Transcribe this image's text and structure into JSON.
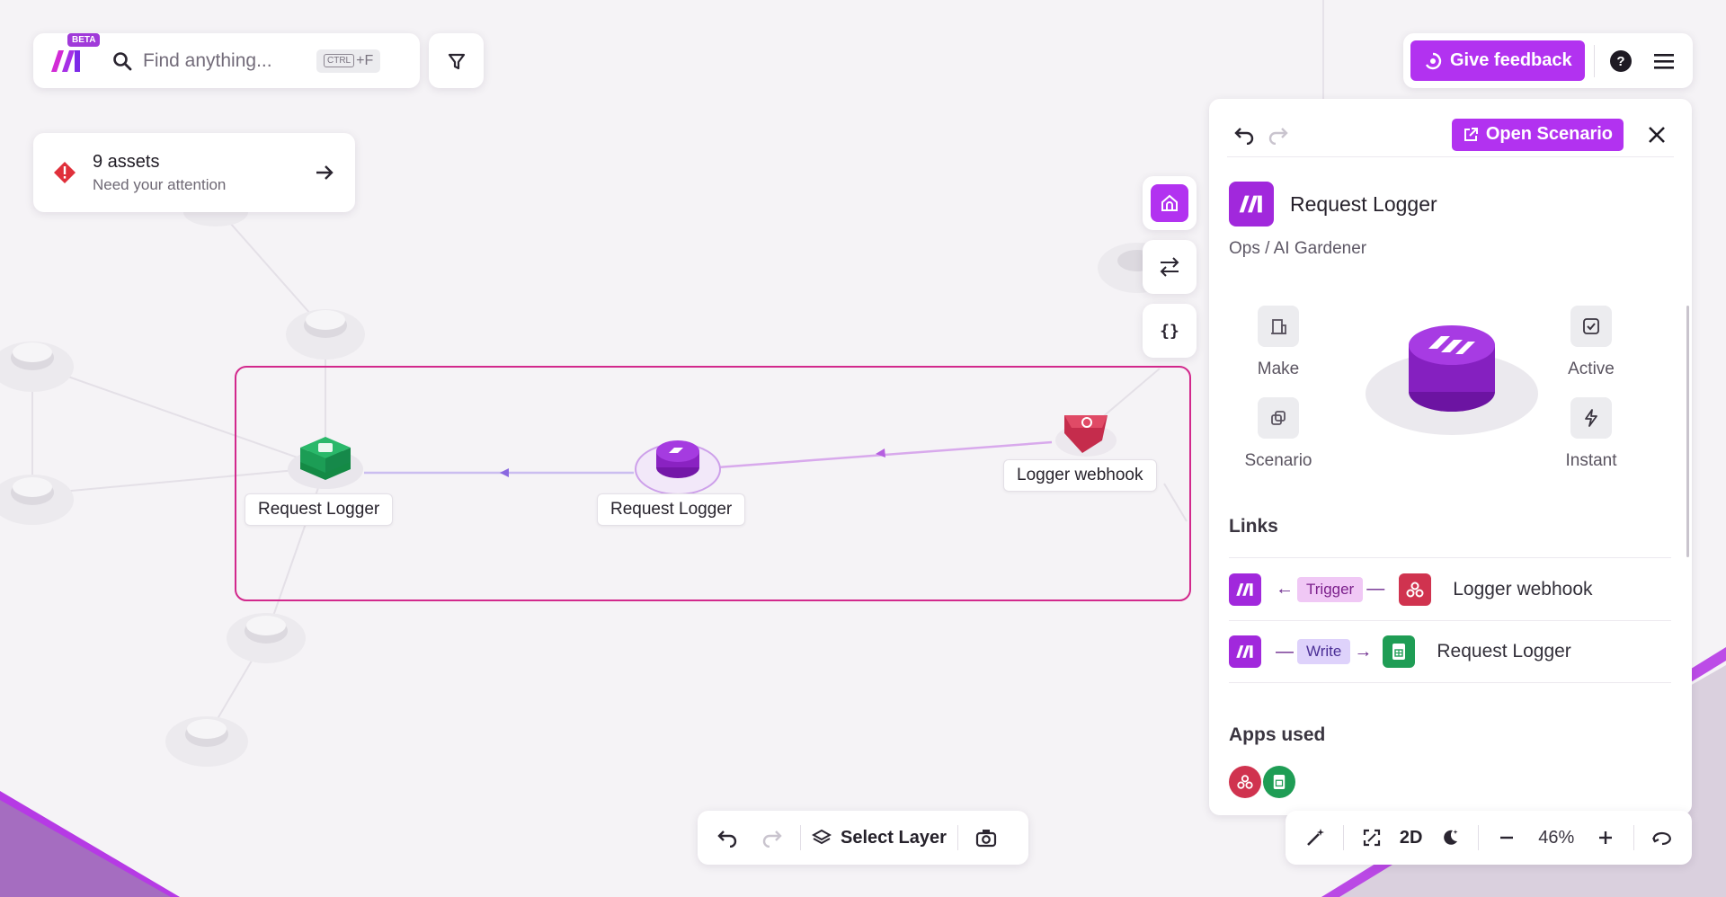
{
  "brand": {
    "badge": "BETA"
  },
  "search": {
    "placeholder": "Find anything...",
    "shortcut_key": "CTRL",
    "shortcut_suffix": "+F"
  },
  "alert": {
    "title": "9 assets",
    "subtitle": "Need your attention"
  },
  "topbar": {
    "feedback_label": "Give feedback"
  },
  "canvas": {
    "nodes": [
      {
        "label": "Request Logger",
        "kind": "google-sheets"
      },
      {
        "label": "Request Logger",
        "kind": "make-scenario"
      },
      {
        "label": "Logger webhook",
        "kind": "webhook"
      }
    ]
  },
  "panel": {
    "open_label": "Open Scenario",
    "title": "Request Logger",
    "breadcrumb": "Ops / AI Gardener",
    "properties": {
      "owner": "Make",
      "type": "Scenario",
      "status": "Active",
      "schedule": "Instant"
    },
    "links_title": "Links",
    "links": [
      {
        "tag": "Trigger",
        "target": "Logger webhook",
        "direction": "incoming"
      },
      {
        "tag": "Write",
        "target": "Request Logger",
        "direction": "outgoing"
      }
    ],
    "apps_title": "Apps used"
  },
  "bottom_toolbar": {
    "layer_label": "Select Layer"
  },
  "view_toolbar": {
    "mode_label": "2D",
    "zoom": "46%"
  },
  "colors": {
    "accent": "#b232f0",
    "selection": "#d2288c",
    "sheets": "#1f9d55",
    "webhook": "#d0334f"
  }
}
